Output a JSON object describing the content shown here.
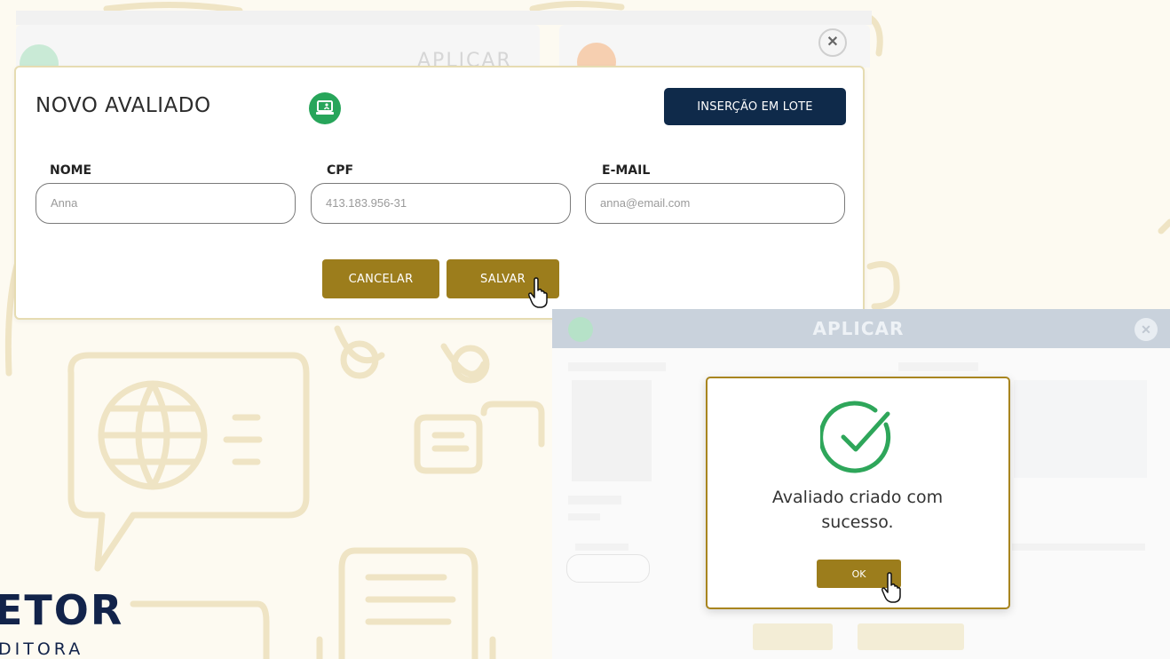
{
  "background_panels": {
    "left_title": "APLICAR"
  },
  "new_evaluee_dialog": {
    "title": "NOVO AVALIADO",
    "batch_button": "INSERÇÃO EM LOTE",
    "close_icon": "close-icon",
    "fields": [
      {
        "label": "NOME",
        "value": "Anna"
      },
      {
        "label": "CPF",
        "value": "413.183.956-31"
      },
      {
        "label": "E-MAIL",
        "value": "anna@email.com"
      }
    ],
    "cancel_button": "CANCELAR",
    "save_button": "SALVAR"
  },
  "apply_window": {
    "title": "APLICAR"
  },
  "success_modal": {
    "message_line1": "Avaliado criado com",
    "message_line2": "sucesso.",
    "ok_button": "OK"
  },
  "logo": {
    "name": "ETOR",
    "subtitle": "DITORA"
  },
  "colors": {
    "gold": "#9c7d1c",
    "navy": "#0f2a4a",
    "green": "#27a55a",
    "success_green": "#2ea65a",
    "modal_border": "#a8851f"
  }
}
